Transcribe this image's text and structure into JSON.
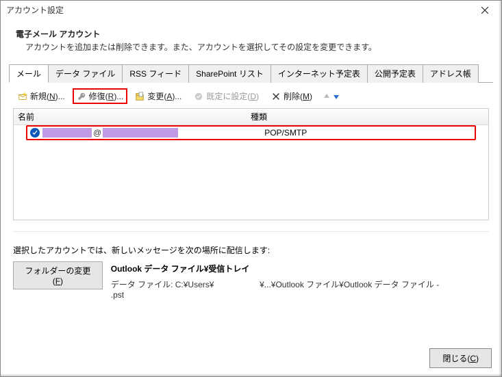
{
  "window": {
    "title": "アカウント設定"
  },
  "section": {
    "heading": "電子メール アカウント",
    "description": "アカウントを追加または削除できます。また、アカウントを選択してその設定を変更できます。"
  },
  "tabs": [
    {
      "label": "メール",
      "active": true
    },
    {
      "label": "データ ファイル",
      "active": false
    },
    {
      "label": "RSS フィード",
      "active": false
    },
    {
      "label": "SharePoint リスト",
      "active": false
    },
    {
      "label": "インターネット予定表",
      "active": false
    },
    {
      "label": "公開予定表",
      "active": false
    },
    {
      "label": "アドレス帳",
      "active": false
    }
  ],
  "toolbar": {
    "new_label": "新規(",
    "new_key": "N",
    "new_suffix": ")...",
    "repair_label": "修復(",
    "repair_key": "R",
    "repair_suffix": ")...",
    "change_label": "変更(",
    "change_key": "A",
    "change_suffix": ")...",
    "setdefault_label": "既定に設定(",
    "setdefault_key": "D",
    "setdefault_suffix": ")",
    "delete_label": "削除(",
    "delete_key": "M",
    "delete_suffix": ")"
  },
  "table": {
    "header_name": "名前",
    "header_type": "種類",
    "rows": [
      {
        "at": "@",
        "type": "POP/SMTP"
      }
    ]
  },
  "delivery": {
    "label": "選択したアカウントでは、新しいメッセージを次の場所に配信します:",
    "change_folder_label": "フォルダーの変更(",
    "change_folder_key": "F",
    "change_folder_suffix": ")",
    "location_bold": "Outlook データ ファイル¥受信トレイ",
    "path_prefix": "データ ファイル: C:¥Users¥",
    "path_middle": "¥...¥Outlook ファイル¥Outlook データ ファイル - ",
    "path_ext": ".pst"
  },
  "footer": {
    "close_label": "閉じる(",
    "close_key": "C",
    "close_suffix": ")"
  }
}
